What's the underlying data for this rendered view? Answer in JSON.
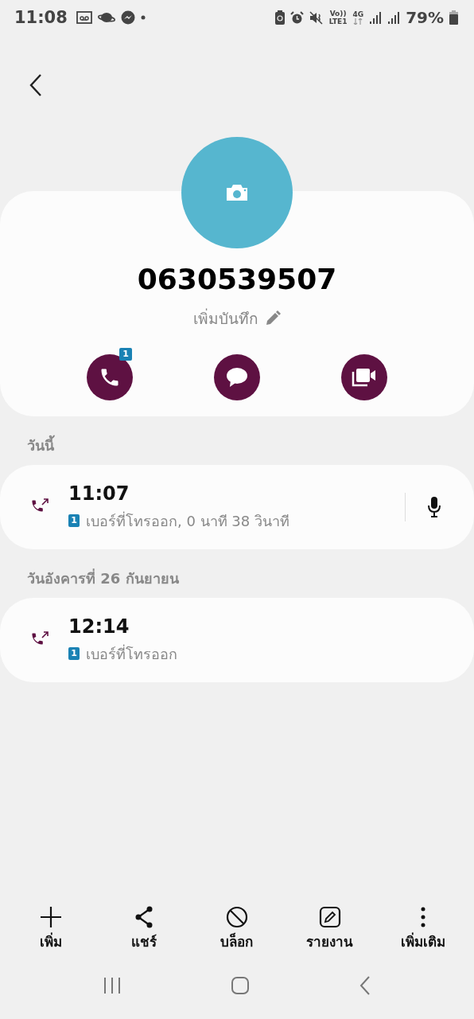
{
  "status_bar": {
    "time": "11:08",
    "volte": "Vo))",
    "lte": "LTE1",
    "network": "4G",
    "battery": "79%"
  },
  "contact": {
    "number": "0630539507",
    "note_hint": "เพิ่มบันทึก",
    "call_badge": "1"
  },
  "groups": [
    {
      "date": "วันนี้",
      "calls": [
        {
          "time": "11:07",
          "sim": "1",
          "detail": "เบอร์ที่โทรออก, 0 นาที 38 วินาที",
          "kind": "outgoing",
          "recording": true
        }
      ]
    },
    {
      "date": "วันอังคารที่ 26 กันยายน",
      "calls": [
        {
          "time": "12:14",
          "sim": "1",
          "detail": "เบอร์ที่โทรออก",
          "kind": "outgoing",
          "recording": false
        }
      ]
    }
  ],
  "bottom_actions": [
    {
      "label": "เพิ่ม",
      "kind": "add"
    },
    {
      "label": "แชร์",
      "kind": "share"
    },
    {
      "label": "บล็อก",
      "kind": "block"
    },
    {
      "label": "รายงาน",
      "kind": "report"
    },
    {
      "label": "เพิ่มเติม",
      "kind": "more"
    }
  ]
}
